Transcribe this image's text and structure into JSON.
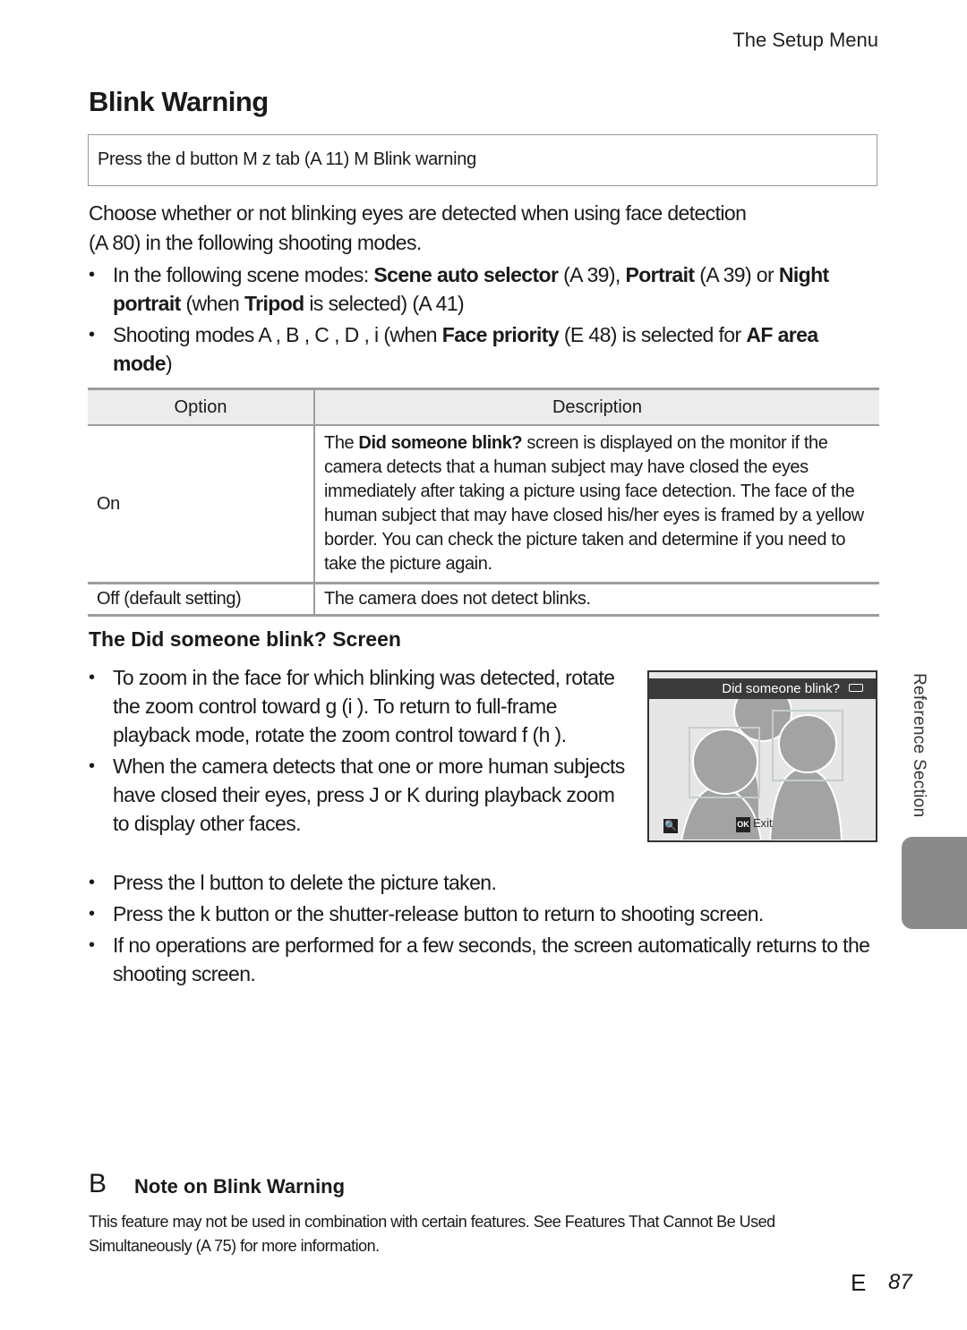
{
  "header": {
    "running_head": "The Setup Menu",
    "title": "Blink Warning"
  },
  "nav_path": "Press the d      button M z tab (A  11) M Blink warning",
  "intro": {
    "line1": "Choose whether or not blinking eyes are detected when using face detection",
    "line2": "(A  80) in the following shooting modes."
  },
  "modes": [
    {
      "pre": "In the following scene modes: ",
      "b1": "Scene auto selector",
      "m1": " (A  39), ",
      "b2": "Portrait",
      "m2": " (A  39) or ",
      "b3": "Night portrait",
      "m3": " (when ",
      "b4": "Tripod",
      "m4": " is selected) (A  41)"
    },
    {
      "pre": "Shooting modes A , B , C , D , i    (when ",
      "b1": "Face priority",
      "m1": " (E  48) is selected for ",
      "b2": "AF area mode",
      "m2": ")"
    }
  ],
  "table": {
    "headers": [
      "Option",
      "Description"
    ],
    "rows": [
      {
        "option": "On",
        "desc_pre": "The ",
        "desc_bold": "Did someone blink?",
        "desc_post": " screen is displayed on the monitor if the camera detects that a human subject may have closed the eyes immediately after taking a picture using face detection. The face of the human subject that may have closed his/her eyes is framed by a yellow border. You can check the picture taken and determine if you need to take the picture again."
      },
      {
        "option": "Off (default setting)",
        "desc_pre": "The camera does not detect blinks.",
        "desc_bold": "",
        "desc_post": ""
      }
    ]
  },
  "screen_section": {
    "title": "The Did someone blink? Screen",
    "bullets": [
      "To zoom in the face for which blinking was detected, rotate the zoom control toward g  (i  ). To return to full-frame playback mode, rotate the zoom control toward f     (h   ).",
      "When the camera detects that one or more human subjects have closed their eyes, press J   or K  during playback zoom to display other faces."
    ],
    "more_bullets": [
      "Press the l    button to delete the picture taken.",
      "Press the k    button or the shutter-release button to return to shooting screen.",
      "If no operations are performed for a few seconds, the screen automatically returns to the shooting screen."
    ]
  },
  "camera_screen": {
    "title": "Did someone blink?",
    "zoom_icon": "🔍",
    "ok_label": "OK",
    "exit_label": "Exit"
  },
  "side_tab": {
    "label": "Reference Section",
    "color": "#8a8a8a"
  },
  "note": {
    "mark": "B",
    "title": "Note on Blink Warning",
    "body": "This feature may not be used in combination with certain features. See  Features That Cannot Be Used Simultaneously  (A  75) for more information."
  },
  "footer": {
    "section_symbol": "E",
    "page_number": "87"
  }
}
